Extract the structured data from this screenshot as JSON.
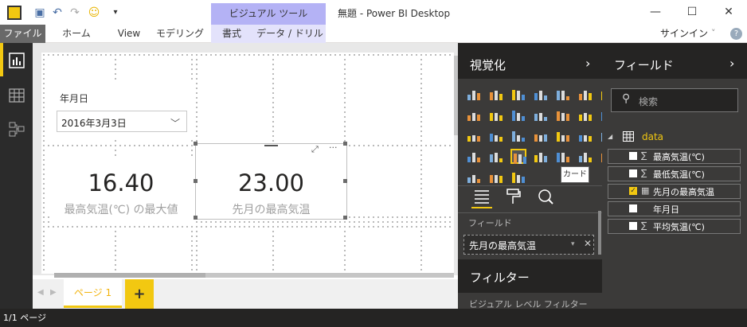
{
  "window": {
    "title": "無題 - Power BI Desktop",
    "context_group": "ビジュアル ツール"
  },
  "ribbon": {
    "tabs": [
      "ファイル",
      "ホーム",
      "View",
      "モデリング"
    ],
    "context_tabs": [
      "書式",
      "データ / ドリル"
    ],
    "signin": "サインイン"
  },
  "canvas": {
    "slicer": {
      "label": "年月日",
      "value": "2016年3月3日"
    },
    "card1": {
      "value": "16.40",
      "label": "最高気温(℃) の最大値"
    },
    "card2": {
      "value": "23.00",
      "label": "先月の最高気温"
    }
  },
  "pages": {
    "tab": "ページ 1",
    "add": "+"
  },
  "status": {
    "text": "1/1 ページ"
  },
  "viz": {
    "title": "視覚化",
    "fields_label": "フィールド",
    "well_value": "先月の最高気温",
    "tooltip": "カード",
    "filters_title": "フィルター",
    "filters_sub": "ビジュアル レベル フィルター"
  },
  "fields": {
    "title": "フィールド",
    "search_placeholder": "検索",
    "table": "data",
    "items": [
      {
        "label": "最高気温(℃)",
        "checked": false,
        "sigma": "∑"
      },
      {
        "label": "最低気温(℃)",
        "checked": false,
        "sigma": "∑"
      },
      {
        "label": "先月の最高気温",
        "checked": true,
        "sigma": "▦"
      },
      {
        "label": "年月日",
        "checked": false,
        "sigma": ""
      },
      {
        "label": "平均気温(℃)",
        "checked": false,
        "sigma": "∑"
      }
    ]
  },
  "colors": {
    "accent": "#f2c811",
    "pane": "#3b3a39",
    "pane_head": "#252423",
    "context": "#b4b2f5"
  }
}
